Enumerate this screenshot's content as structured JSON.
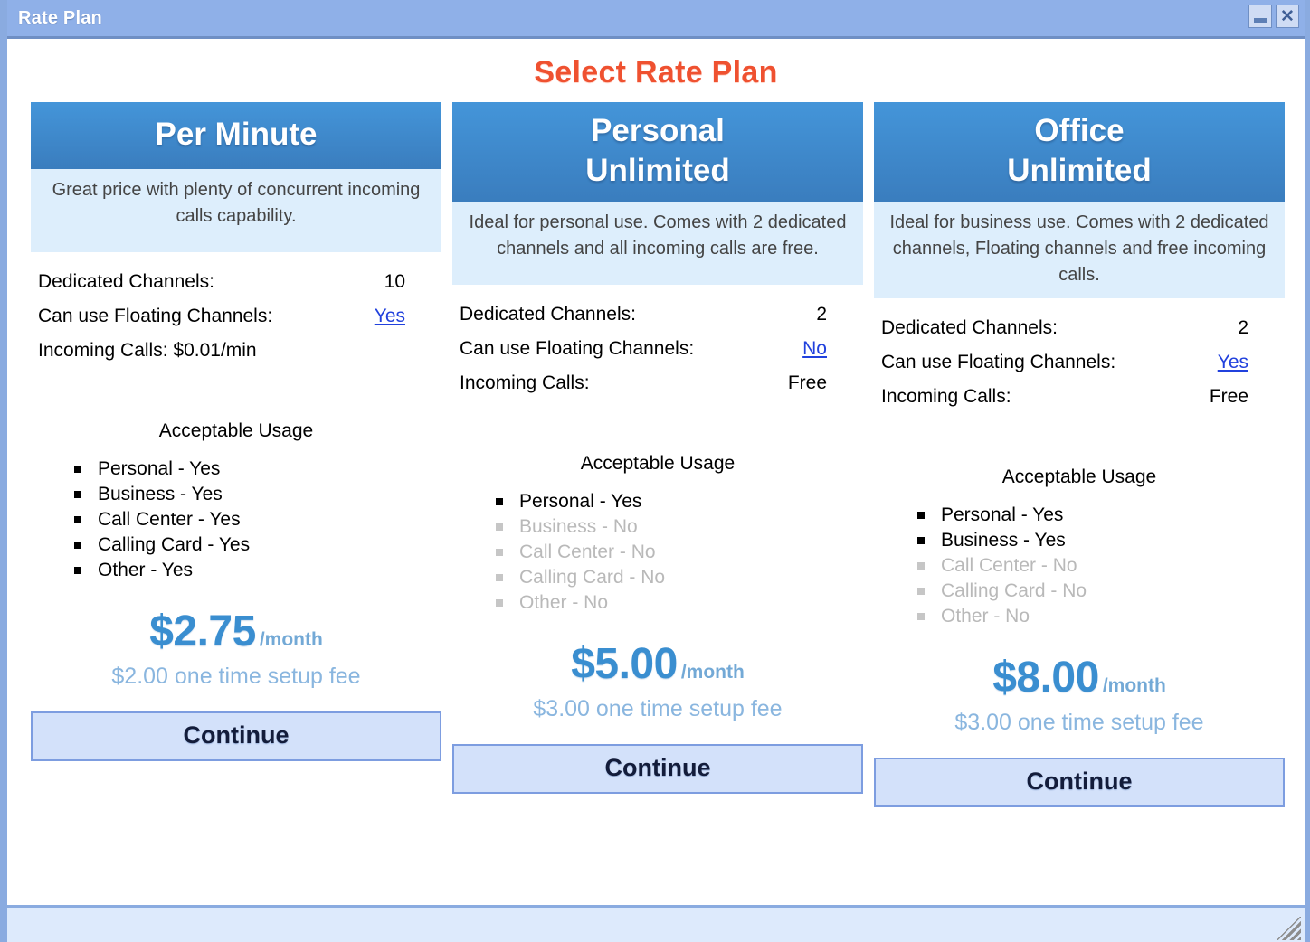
{
  "window": {
    "title": "Rate Plan",
    "minimize_label": "—",
    "close_label": "✕"
  },
  "page_title": "Select Rate Plan",
  "colors": {
    "accent_title": "#ef5130",
    "header_gradient_top": "#4495d9",
    "header_gradient_bottom": "#3a7dbe",
    "desc_background": "#ddeefc",
    "price_blue": "#3a8ed0",
    "setup_fee_blue": "#8ab6df",
    "link_blue": "#2141dd",
    "disabled_gray": "#b9b9b9",
    "button_background": "#d3e1fa",
    "button_border": "#7d9de0",
    "titlebar": "#8fb0e8"
  },
  "plans": [
    {
      "name": "Per Minute",
      "name_line1": "Per Minute",
      "name_line2": "",
      "description": "Great price with plenty of concurrent incoming calls capability.",
      "specs": [
        {
          "label": "Dedicated Channels:",
          "value": "10",
          "is_link": false
        },
        {
          "label": "Can use Floating Channels:",
          "value": "Yes",
          "is_link": true
        },
        {
          "label": "Incoming Calls: $0.01/min",
          "value": "",
          "is_link": false
        }
      ],
      "usage_title": "Acceptable Usage",
      "usage": [
        {
          "text": "Personal - Yes",
          "enabled": true
        },
        {
          "text": "Business - Yes",
          "enabled": true
        },
        {
          "text": "Call Center - Yes",
          "enabled": true
        },
        {
          "text": "Calling Card - Yes",
          "enabled": true
        },
        {
          "text": "Other - Yes",
          "enabled": true
        }
      ],
      "price": "$2.75",
      "price_period": "/month",
      "setup_fee": "$2.00 one time setup fee",
      "continue_label": "Continue"
    },
    {
      "name": "Personal Unlimited",
      "name_line1": "Personal",
      "name_line2": "Unlimited",
      "description": "Ideal for personal use. Comes with 2 dedicated channels and all incoming calls are free.",
      "specs": [
        {
          "label": "Dedicated Channels:",
          "value": "2",
          "is_link": false
        },
        {
          "label": "Can use Floating Channels:",
          "value": "No",
          "is_link": true
        },
        {
          "label": "Incoming Calls:",
          "value": "Free",
          "is_link": false
        }
      ],
      "usage_title": "Acceptable Usage",
      "usage": [
        {
          "text": "Personal - Yes",
          "enabled": true
        },
        {
          "text": "Business - No",
          "enabled": false
        },
        {
          "text": "Call Center - No",
          "enabled": false
        },
        {
          "text": "Calling Card - No",
          "enabled": false
        },
        {
          "text": "Other - No",
          "enabled": false
        }
      ],
      "price": "$5.00",
      "price_period": "/month",
      "setup_fee": "$3.00 one time setup fee",
      "continue_label": "Continue"
    },
    {
      "name": "Office Unlimited",
      "name_line1": "Office",
      "name_line2": "Unlimited",
      "description": "Ideal for business use. Comes with 2 dedicated channels, Floating channels and free incoming calls.",
      "specs": [
        {
          "label": "Dedicated Channels:",
          "value": "2",
          "is_link": false
        },
        {
          "label": "Can use Floating Channels:",
          "value": "Yes",
          "is_link": true
        },
        {
          "label": "Incoming Calls:",
          "value": "Free",
          "is_link": false
        }
      ],
      "usage_title": "Acceptable Usage",
      "usage": [
        {
          "text": "Personal - Yes",
          "enabled": true
        },
        {
          "text": "Business - Yes",
          "enabled": true
        },
        {
          "text": "Call Center - No",
          "enabled": false
        },
        {
          "text": "Calling Card - No",
          "enabled": false
        },
        {
          "text": "Other - No",
          "enabled": false
        }
      ],
      "price": "$8.00",
      "price_period": "/month",
      "setup_fee": "$3.00 one time setup fee",
      "continue_label": "Continue"
    }
  ]
}
